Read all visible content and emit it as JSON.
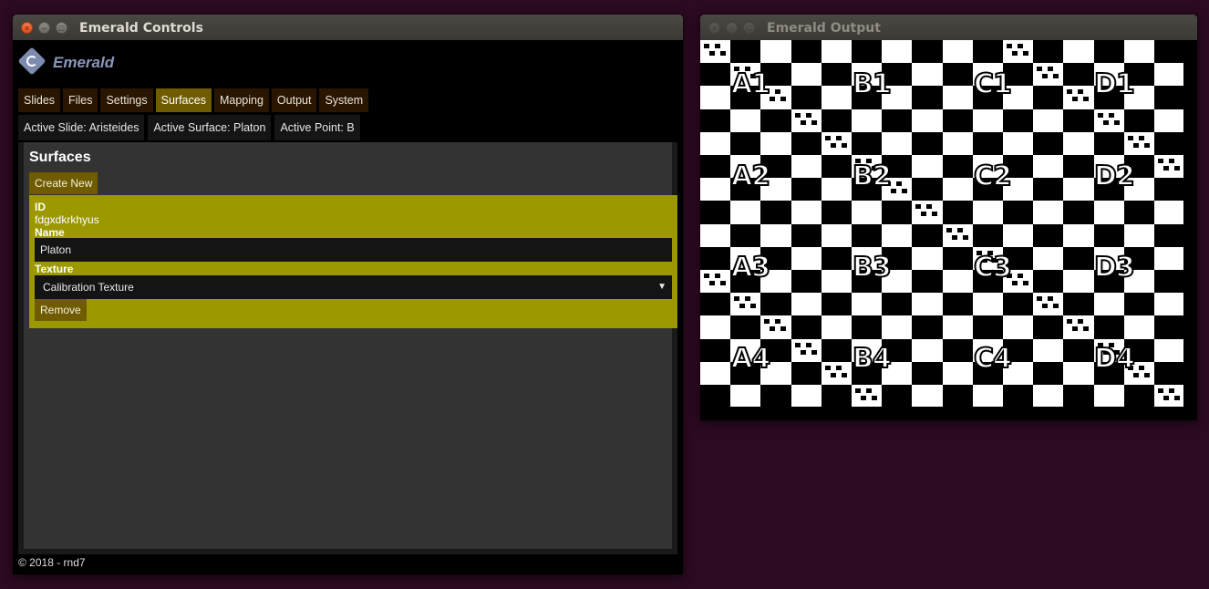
{
  "controls_window": {
    "title": "Emerald Controls",
    "brand": "Emerald",
    "tabs": [
      {
        "label": "Slides",
        "active": false
      },
      {
        "label": "Files",
        "active": false
      },
      {
        "label": "Settings",
        "active": false
      },
      {
        "label": "Surfaces",
        "active": true
      },
      {
        "label": "Mapping",
        "active": false
      },
      {
        "label": "Output",
        "active": false
      },
      {
        "label": "System",
        "active": false
      }
    ],
    "status": {
      "slide": "Active Slide: Aristeides",
      "surface": "Active Surface: Platon",
      "point": "Active Point: B"
    },
    "panel": {
      "title": "Surfaces",
      "create_label": "Create New",
      "surface": {
        "id_label": "ID",
        "id_value": "fdgxdkrkhyus",
        "name_label": "Name",
        "name_value": "Platon",
        "texture_label": "Texture",
        "texture_value": "Calibration Texture",
        "remove_label": "Remove"
      }
    },
    "footer": "© 2018 - rnd7"
  },
  "output_window": {
    "title": "Emerald Output",
    "grid_labels": [
      "A1",
      "B1",
      "C1",
      "D1",
      "A2",
      "B2",
      "C2",
      "D2",
      "A3",
      "B3",
      "C3",
      "D3",
      "A4",
      "B4",
      "C4",
      "D4"
    ]
  },
  "colors": {
    "desktop": "#2c0a21",
    "active_tab": "#6f5c00",
    "surface_card": "#9b9800",
    "brand": "#8a97bd"
  }
}
